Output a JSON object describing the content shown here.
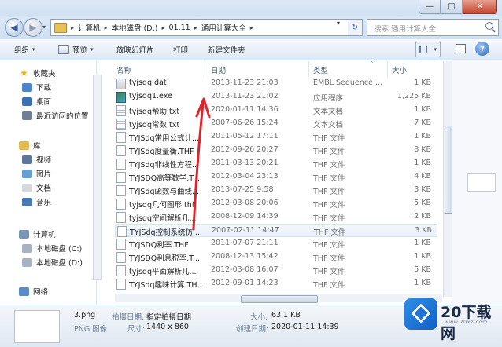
{
  "window": {
    "minimize_glyph": "—",
    "maximize_glyph": "□",
    "close_glyph": "✕"
  },
  "navigation": {
    "back_glyph": "◀",
    "forward_glyph": "▶",
    "recent_glyph": "▾",
    "breadcrumbs": [
      "计算机",
      "本地磁盘 (D:)",
      "01.11",
      "通用计算大全"
    ],
    "separator": "▸",
    "dropdown_glyph": "▾",
    "refresh_glyph": "↻",
    "search_placeholder": "搜索 通用计算大全"
  },
  "toolbar": {
    "organize": "组织",
    "preview": "预览",
    "slideshow": "放映幻灯片",
    "print": "打印",
    "new_folder": "新建文件夹",
    "dropdown_glyph": "▾",
    "help_glyph": "?"
  },
  "sidebar": {
    "favorites": {
      "label": "收藏夹",
      "items": [
        "下载",
        "桌面",
        "最近访问的位置"
      ]
    },
    "libraries": {
      "label": "库",
      "items": [
        "视频",
        "图片",
        "文档",
        "音乐"
      ]
    },
    "computer": {
      "label": "计算机",
      "items": [
        "本地磁盘 (C:)",
        "本地磁盘 (D:)"
      ]
    },
    "network": {
      "label": "网络"
    }
  },
  "columns": {
    "name": "名称",
    "date": "日期",
    "type": "类型",
    "size": "大小",
    "sort_glyph": "^"
  },
  "files": [
    {
      "name": "tyjsdq.dat",
      "date": "2013-11-23 21:03",
      "type": "EMBL Sequence ...",
      "size": "1 KB",
      "icon": "dat"
    },
    {
      "name": "tyjsdq1.exe",
      "date": "2013-11-23 21:02",
      "type": "应用程序",
      "size": "1,225 KB",
      "icon": "exe"
    },
    {
      "name": "tyjsdq帮助.txt",
      "date": "2020-01-11 14:36",
      "type": "文本文档",
      "size": "1 KB",
      "icon": "txt"
    },
    {
      "name": "tyjsdq常数.txt",
      "date": "2007-06-26 15:24",
      "type": "文本文档",
      "size": "7 KB",
      "icon": "txt"
    },
    {
      "name": "TYJSdq常用公式计...",
      "date": "2011-05-12 17:11",
      "type": "THF 文件",
      "size": "1 KB",
      "icon": "blank"
    },
    {
      "name": "TYJSdq度量衡.THF",
      "date": "2012-09-26 20:27",
      "type": "THF 文件",
      "size": "8 KB",
      "icon": "blank"
    },
    {
      "name": "TYJSdq非线性方程...",
      "date": "2011-03-13 20:21",
      "type": "THF 文件",
      "size": "1 KB",
      "icon": "blank"
    },
    {
      "name": "TYJSDQ高等数学.T...",
      "date": "2012-03-04 23:13",
      "type": "THF 文件",
      "size": "4 KB",
      "icon": "blank"
    },
    {
      "name": "TYJSdq函数与曲线...",
      "date": "2013-07-25 9:58",
      "type": "THF 文件",
      "size": "3 KB",
      "icon": "blank"
    },
    {
      "name": "tyjsdq几何图形.thf",
      "date": "2012-03-08 20:06",
      "type": "THF 文件",
      "size": "5 KB",
      "icon": "blank"
    },
    {
      "name": "tyjsdq空间解析几...",
      "date": "2008-12-09 14:39",
      "type": "THF 文件",
      "size": "2 KB",
      "icon": "blank"
    },
    {
      "name": "TYJSdq控制系统仿...",
      "date": "2007-02-11 14:47",
      "type": "THF 文件",
      "size": "3 KB",
      "icon": "blank",
      "highlight": true
    },
    {
      "name": "TYJSDQ利率.THF",
      "date": "2011-07-07 21:11",
      "type": "THF 文件",
      "size": "1 KB",
      "icon": "blank"
    },
    {
      "name": "TYJSDQ利息税率.T...",
      "date": "2008-12-13 15:42",
      "type": "THF 文件",
      "size": "1 KB",
      "icon": "blank"
    },
    {
      "name": "tyjsdq平面解析几...",
      "date": "2012-03-08 16:07",
      "type": "THF 文件",
      "size": "5 KB",
      "icon": "blank"
    },
    {
      "name": "TYJSdq趣味计算.TH...",
      "date": "2012-09-01 14:23",
      "type": "THF 文件",
      "size": "1 KB",
      "icon": "blank"
    }
  ],
  "details": {
    "filename": "3.png",
    "filetype": "PNG 图像",
    "shot_date_label": "拍摄日期:",
    "shot_date_value": "指定拍摄日期",
    "size_dim_label": "尺寸:",
    "size_dim_value": "1440 x 860",
    "filesize_label": "大小:",
    "filesize_value": "63.1 KB",
    "created_label": "创建日期:",
    "created_value": "2020-01-11 14:39"
  },
  "watermark": {
    "text": "20下载网",
    "url": "www.20xz.com"
  },
  "colors": {
    "accent": "#2c6cc0",
    "annotation": "#d9252b"
  }
}
